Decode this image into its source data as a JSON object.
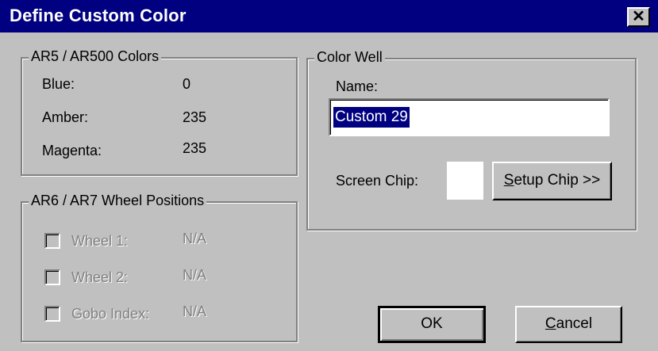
{
  "window": {
    "title": "Define Custom Color",
    "close_glyph": "✕"
  },
  "ar5_group": {
    "title": "AR5 / AR500 Colors",
    "rows": [
      {
        "label": "Blue:",
        "value": "0"
      },
      {
        "label": "Amber:",
        "value": "235"
      },
      {
        "label": "Magenta:",
        "value": "235"
      }
    ]
  },
  "ar6_group": {
    "title": "AR6 / AR7 Wheel Positions",
    "rows": [
      {
        "label": "Wheel 1:",
        "value": "N/A",
        "checked": false
      },
      {
        "label": "Wheel 2:",
        "value": "N/A",
        "checked": false
      },
      {
        "label": "Gobo Index:",
        "value": "N/A",
        "checked": false
      }
    ]
  },
  "color_well": {
    "title": "Color Well",
    "name_label": "Name:",
    "name_value": "Custom 29",
    "screen_chip_label": "Screen Chip:",
    "chip_color": "#ffffff",
    "setup_chip": {
      "pre": "",
      "underlined": "S",
      "post": "etup Chip >>"
    }
  },
  "buttons": {
    "ok": "OK",
    "cancel": {
      "pre": "",
      "underlined": "C",
      "post": "ancel"
    }
  },
  "colors": {
    "titlebar": "#000080",
    "face": "#c0c0c0",
    "disabled_text": "#808080"
  }
}
